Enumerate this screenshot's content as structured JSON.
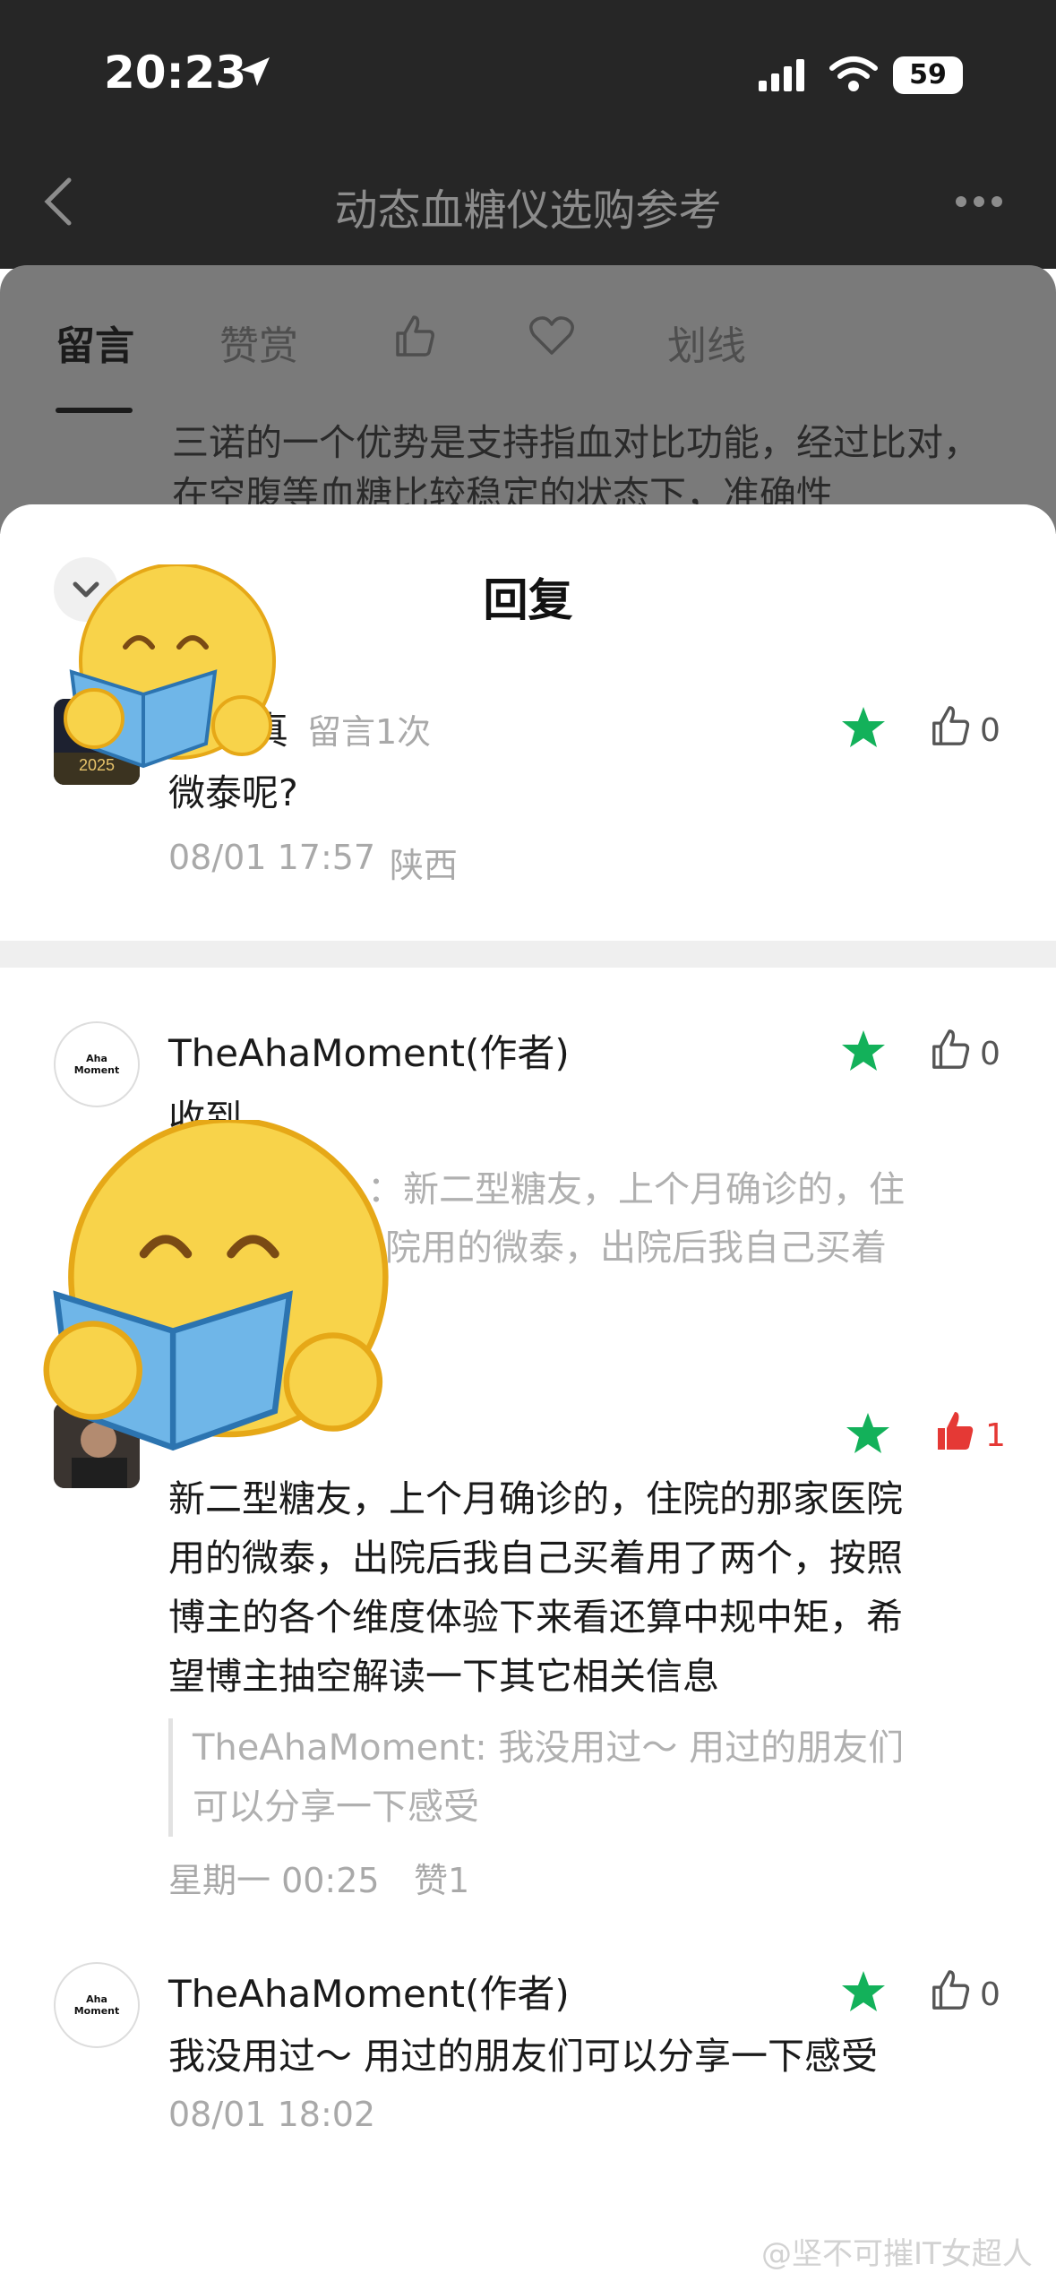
{
  "status": {
    "time": "20:23",
    "battery": "59"
  },
  "nav": {
    "title": "动态血糖仪选购参考"
  },
  "tabs": [
    "留言",
    "赞赏",
    "划线"
  ],
  "background_comment": {
    "text": "三诺的一个优势是支持指血对比功能，经过比对，在空腹等血糖比较稳定的状态下，准确性"
  },
  "modal": {
    "title": "回复"
  },
  "main_comment": {
    "name_partial": "真",
    "badge": "留言1次",
    "text": "微泰呢?",
    "time": "08/01 17:57",
    "location": "陕西",
    "likes": "0"
  },
  "replies": [
    {
      "name": "TheAhaMoment(作者)",
      "text": "收到",
      "quote_line1": "：新二型糖友，上个月确诊的，住",
      "quote_line2": "院用的微泰，出院后我自己买着",
      "likes": "0"
    },
    {
      "text_lines": [
        "新二型糖友，上个月确诊的，住院的那家医院",
        "用的微泰，出院后我自己买着用了两个，按照",
        "博主的各个维度体验下来看还算中规中矩，希",
        "望博主抽空解读一下其它相关信息"
      ],
      "quote_lines": [
        "TheAhaMoment: 我没用过～ 用过的朋友们",
        "可以分享一下感受"
      ],
      "time": "星期一 00:25",
      "like_label": "赞1",
      "likes": "1"
    },
    {
      "name": "TheAhaMoment(作者)",
      "text": "我没用过～ 用过的朋友们可以分享一下感受",
      "time": "08/01 18:02",
      "likes": "0"
    }
  ],
  "avatar_text": {
    "line1": "Aha",
    "line2": "Moment"
  },
  "watermark": "@坚不可摧IT女超人",
  "colors": {
    "star": "#13b15a",
    "liked": "#e53935",
    "muted": "#a9a9a9"
  }
}
